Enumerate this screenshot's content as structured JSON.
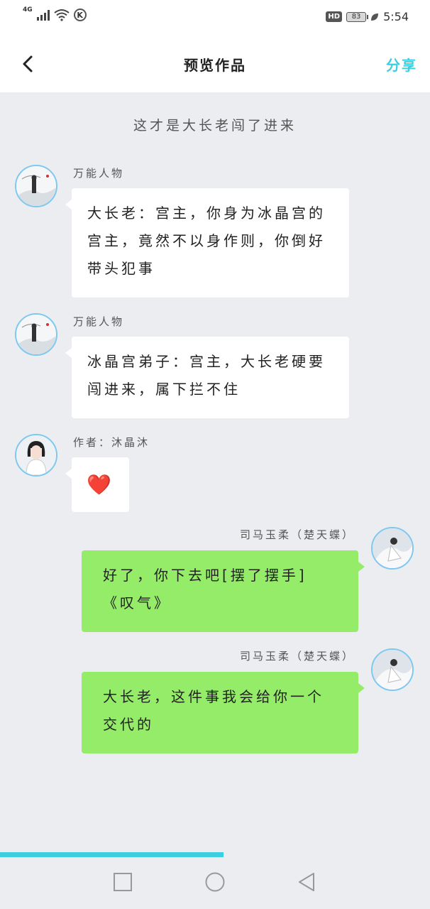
{
  "status_bar": {
    "network": "4G",
    "k_badge": "K",
    "hd_badge": "HD",
    "battery": "83",
    "time": "5:54"
  },
  "header": {
    "title": "预览作品",
    "share_label": "分享",
    "accent_color": "#3ccfe0"
  },
  "chat": {
    "narration": "这才是大长老闯了进来",
    "messages": [
      {
        "sender": "万能人物",
        "text": "大长老：宫主，你身为冰晶宫的宫主，竟然不以身作则，你倒好带头犯事"
      },
      {
        "sender": "万能人物",
        "text": "冰晶宫弟子：宫主，大长老硬要闯进来，属下拦不住"
      },
      {
        "sender": "作者：沐晶沐",
        "emoji": "❤️"
      },
      {
        "sender": "司马玉柔（楚天蝶）",
        "text": "好了，你下去吧[摆了摆手]《叹气》"
      },
      {
        "sender": "司马玉柔（楚天蝶）",
        "text": "大长老，这件事我会给你一个交代的"
      }
    ],
    "bubble_colors": {
      "left": "#ffffff",
      "right": "#95ec69"
    }
  },
  "playback": {
    "progress": 0.52
  },
  "nav_icons": [
    "square-icon",
    "circle-icon",
    "triangle-back-icon"
  ]
}
